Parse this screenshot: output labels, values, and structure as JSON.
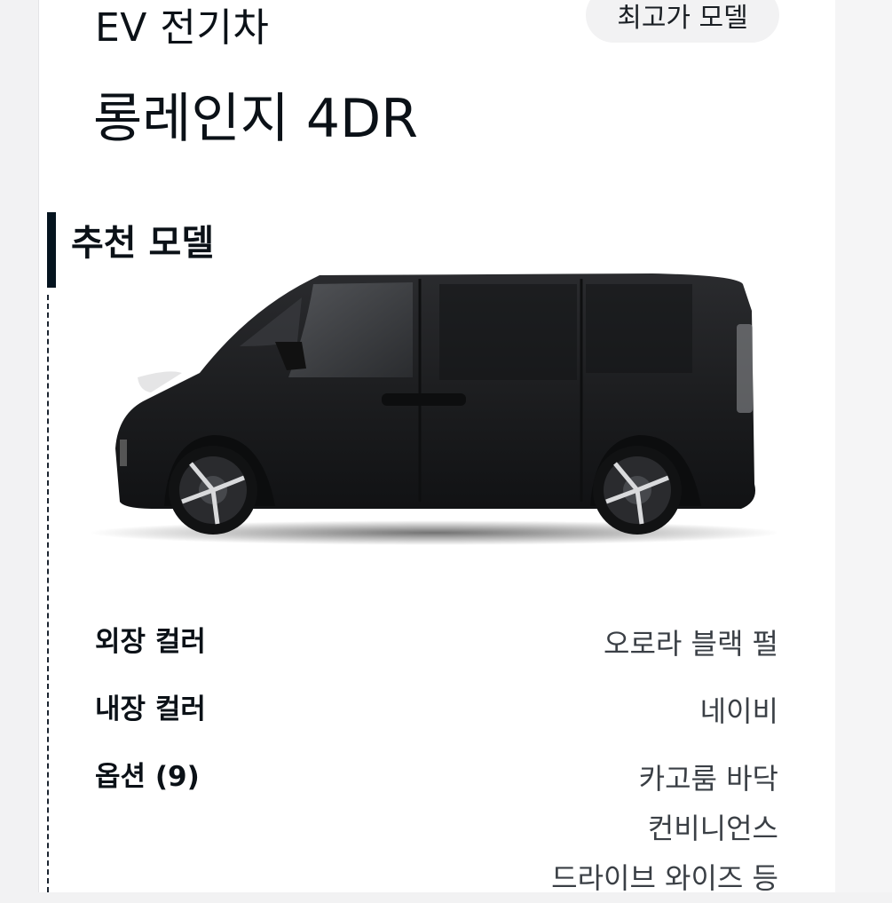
{
  "header": {
    "category": "EV 전기차",
    "model_name": "롱레인지 4DR",
    "tag_button_label": "최고가 모델"
  },
  "section": {
    "title": "추천 모델"
  },
  "car": {
    "color": "#1c1d1f",
    "image_icon": "van-side-view"
  },
  "specs": [
    {
      "label": "외장 컬러",
      "values": [
        "오로라 블랙 펄"
      ]
    },
    {
      "label": "내장 컬러",
      "values": [
        "네이비"
      ]
    },
    {
      "label": "옵션 (9)",
      "values": [
        "카고룸 바닥",
        "컨비니언스",
        "드라이브 와이즈 등"
      ]
    }
  ],
  "colors": {
    "accent": "#05141f",
    "background": "#ffffff",
    "chip_background": "#f2f2f3"
  }
}
